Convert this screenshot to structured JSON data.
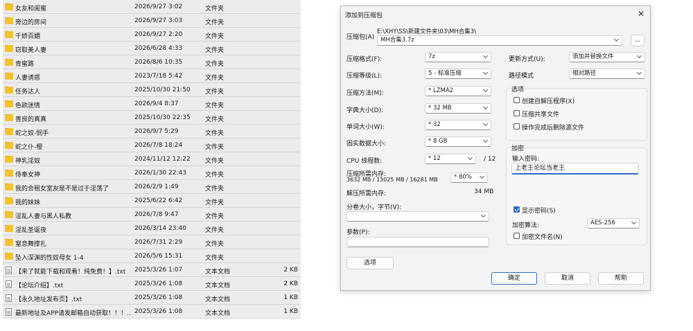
{
  "files": [
    {
      "name": "女友和闺蜜",
      "date": "2026/9/27 3:02",
      "type": "文件夹",
      "size": "",
      "kind": "folder"
    },
    {
      "name": "旁边的房间",
      "date": "2026/9/27 3:03",
      "type": "文件夹",
      "size": "",
      "kind": "folder"
    },
    {
      "name": "千娇百媚",
      "date": "2026/9/27 2:20",
      "type": "文件夹",
      "size": "",
      "kind": "folder"
    },
    {
      "name": "窃取美人妻",
      "date": "2026/6/28 4:33",
      "type": "文件夹",
      "size": "",
      "kind": "folder"
    },
    {
      "name": "青蜜路",
      "date": "2026/8/6 10:35",
      "type": "文件夹",
      "size": "",
      "kind": "folder"
    },
    {
      "name": "人妻诱惑",
      "date": "2023/7/18 5:42",
      "type": "文件夹",
      "size": "",
      "kind": "folder"
    },
    {
      "name": "任务达人",
      "date": "2025/10/30 21:50",
      "type": "文件夹",
      "size": "",
      "kind": "folder"
    },
    {
      "name": "色欲迷情",
      "date": "2026/9/4 8:37",
      "type": "文件夹",
      "size": "",
      "kind": "folder"
    },
    {
      "name": "善良的真真",
      "date": "2025/10/30 22:35",
      "type": "文件夹",
      "size": "",
      "kind": "folder"
    },
    {
      "name": "蛇之奴-悯手",
      "date": "2026/9/7 5:29",
      "type": "文件夹",
      "size": "",
      "kind": "folder"
    },
    {
      "name": "蛇之仆-樱",
      "date": "2026/7/8 18:24",
      "type": "文件夹",
      "size": "",
      "kind": "folder"
    },
    {
      "name": "神乳淫奴",
      "date": "2024/11/12 12:22",
      "type": "文件夹",
      "size": "",
      "kind": "folder"
    },
    {
      "name": "侍奉女神",
      "date": "2026/1/30 22:43",
      "type": "文件夹",
      "size": "",
      "kind": "folder"
    },
    {
      "name": "我的合租女室友是不是过于淫荡了",
      "date": "2026/2/9 1:49",
      "type": "文件夹",
      "size": "",
      "kind": "folder"
    },
    {
      "name": "我的妹妹",
      "date": "2025/6/22 6:42",
      "type": "文件夹",
      "size": "",
      "kind": "folder"
    },
    {
      "name": "淫乱人妻与黑人私教",
      "date": "2026/7/8 9:47",
      "type": "文件夹",
      "size": "",
      "kind": "folder"
    },
    {
      "name": "淫乱圣诞夜",
      "date": "2026/3/14 23:40",
      "type": "文件夹",
      "size": "",
      "kind": "folder"
    },
    {
      "name": "窒息舞撑扎",
      "date": "2026/7/31 2:29",
      "type": "文件夹",
      "size": "",
      "kind": "folder"
    },
    {
      "name": "坠入深渊的性奴母女 1-4",
      "date": "2026/5/6 15:31",
      "type": "文件夹",
      "size": "",
      "kind": "folder"
    },
    {
      "name": "【来了就能下载和观看！纯免费！】.txt",
      "date": "2025/3/26 1:07",
      "type": "文本文档",
      "size": "2 KB",
      "kind": "txt"
    },
    {
      "name": "【论坛介绍】.txt",
      "date": "2025/3/26 1:08",
      "type": "文本文档",
      "size": "2 KB",
      "kind": "txt"
    },
    {
      "name": "【永久地址发布页】.txt",
      "date": "2025/3/26 1:08",
      "type": "文本文档",
      "size": "1 KB",
      "kind": "txt"
    },
    {
      "name": "最新地址及APP请发邮箱自动获取！！！....",
      "date": "2025/3/26 1:08",
      "type": "文本文档",
      "size": "1 KB",
      "kind": "txt"
    }
  ],
  "dialog": {
    "title": "添加到压缩包",
    "archive_label": "压缩包(A)",
    "archive_path": "E:\\XHY\\SS\\新建文件夹\\03\\MH合集3\\",
    "archive_name": "MH合集3.7z",
    "browse_label": "...",
    "format_label": "压缩格式(F):",
    "format_value": "7z",
    "level_label": "压缩等级(L):",
    "level_value": "5 - 标准压缩",
    "method_label": "压缩方法(M):",
    "method_value": "* LZMA2",
    "dict_label": "字典大小(D):",
    "dict_value": "* 32 MB",
    "word_label": "单词大小(W):",
    "word_value": "* 32",
    "solid_label": "固实数据大小:",
    "solid_value": "* 8 GB",
    "cpu_label": "CPU 线程数:",
    "cpu_value": "* 12",
    "cpu_max": "/ 12",
    "mem_comp_label": "压缩所需内存:",
    "mem_comp_value": "3632 MB / 13025 MB / 16281 MB",
    "mem_percent": "* 80%",
    "mem_decomp_label": "解压所需内存:",
    "mem_decomp_value": "34 MB",
    "split_label": "分卷大小，字节(V):",
    "split_value": "",
    "params_label": "参数(P):",
    "params_value": "",
    "options_button": "选项",
    "update_label": "更新方式(U):",
    "update_value": "添加并替换文件",
    "path_label": "路径模式",
    "path_value": "相对路径",
    "options_group": "选项",
    "opt_sfx": "创建自解压程序(X)",
    "opt_shared": "压缩共享文件",
    "opt_delete": "操作完成后删除源文件",
    "encrypt_group": "加密",
    "password_label": "输入密码:",
    "password_value": "上老王论坛当老王",
    "show_password": "显示密码(S)",
    "enc_method_label": "加密算法:",
    "enc_method_value": "AES-256",
    "enc_names": "加密文件名(N)",
    "ok": "确定",
    "cancel": "取消",
    "help": "帮助"
  }
}
